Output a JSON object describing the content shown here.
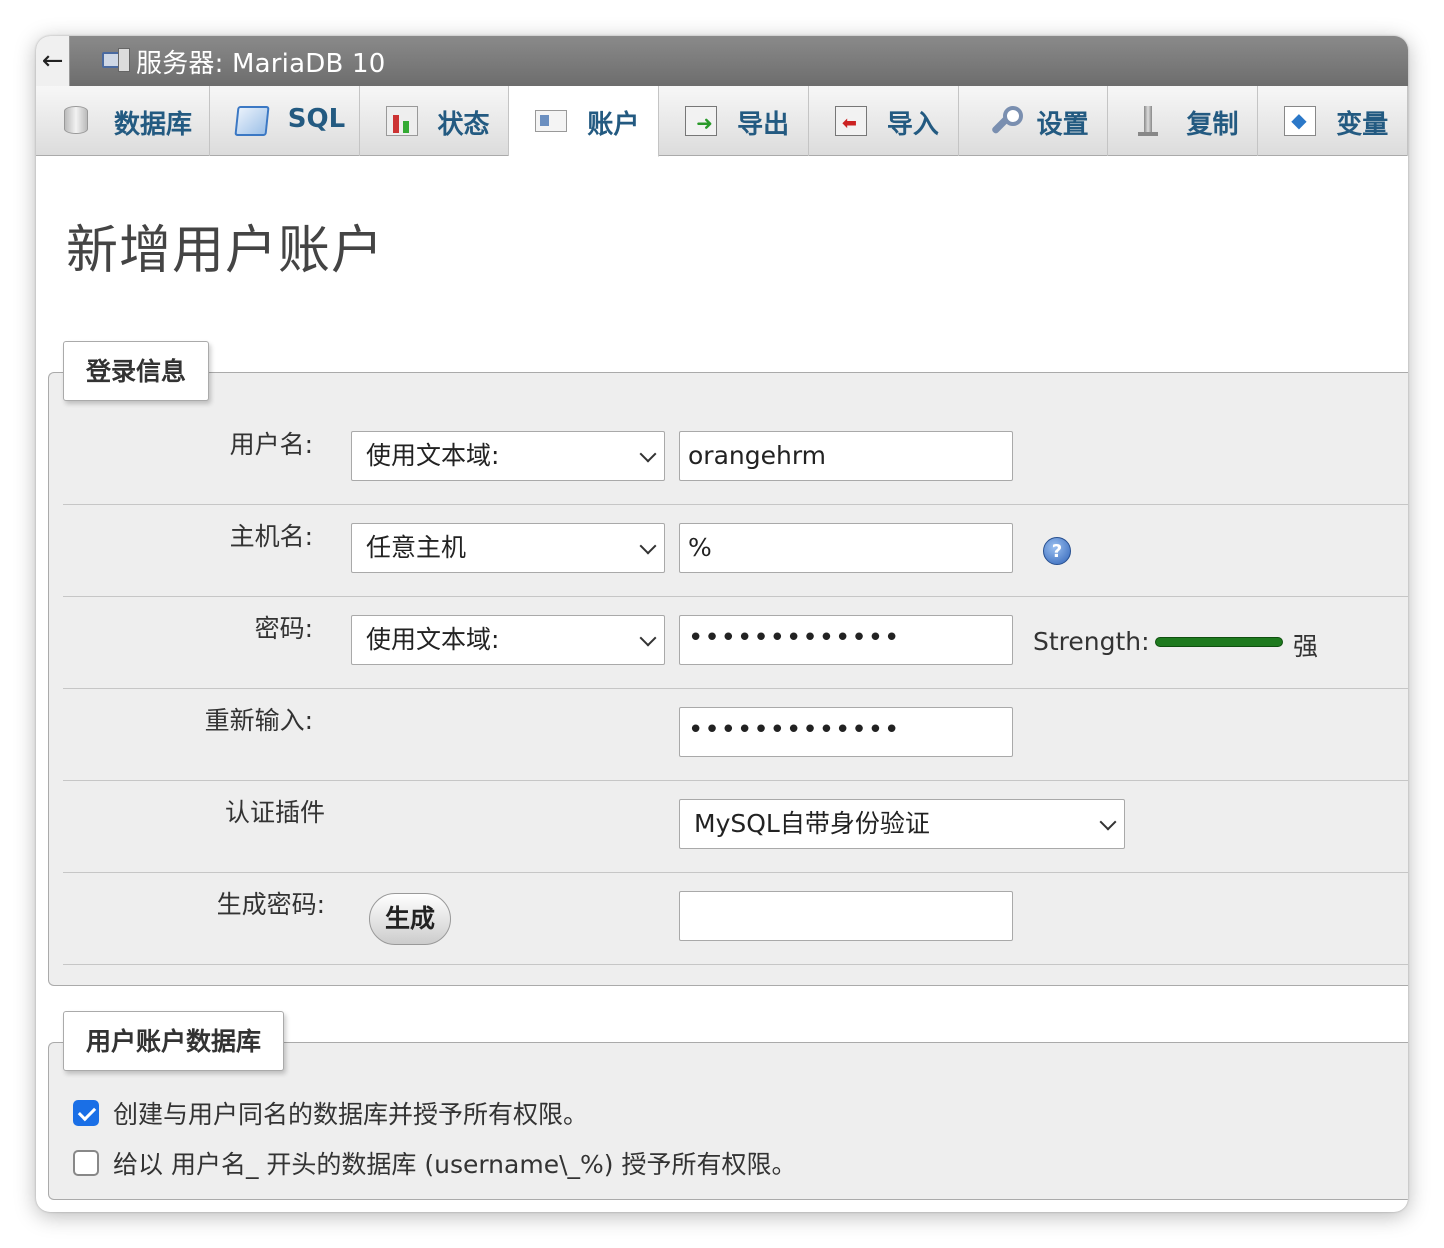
{
  "titlebar": {
    "back": "←",
    "title": "服务器: MariaDB 10"
  },
  "tabs": [
    {
      "label": "数据库",
      "icon": "database-icon"
    },
    {
      "label": "SQL",
      "icon": "sql-icon"
    },
    {
      "label": "状态",
      "icon": "status-icon"
    },
    {
      "label": "账户",
      "icon": "accounts-icon",
      "active": true
    },
    {
      "label": "导出",
      "icon": "export-icon"
    },
    {
      "label": "导入",
      "icon": "import-icon"
    },
    {
      "label": "设置",
      "icon": "settings-icon"
    },
    {
      "label": "复制",
      "icon": "replication-icon"
    },
    {
      "label": "变量",
      "icon": "variables-icon"
    }
  ],
  "page_title": "新增用户账户",
  "login": {
    "legend": "登录信息",
    "username": {
      "label": "用户名:",
      "select": "使用文本域:",
      "value": "orangehrm"
    },
    "hostname": {
      "label": "主机名:",
      "select": "任意主机",
      "value": "%"
    },
    "password": {
      "label": "密码:",
      "select": "使用文本域:",
      "value": "•••••••••••••",
      "strength_label": "Strength:",
      "strength_text": "强",
      "strength_color": "#1e7a1e",
      "strength_level": 1.0
    },
    "retype": {
      "label": "重新输入:",
      "value": "•••••••••••••"
    },
    "auth": {
      "label": "认证插件",
      "select": "MySQL自带身份验证"
    },
    "generate": {
      "label": "生成密码:",
      "button": "生成",
      "value": ""
    }
  },
  "db": {
    "legend": "用户账户数据库",
    "option1": {
      "label": "创建与用户同名的数据库并授予所有权限。",
      "checked": true
    },
    "option2": {
      "label": "给以 用户名_ 开头的数据库 (username\\_%) 授予所有权限。",
      "checked": false
    }
  }
}
